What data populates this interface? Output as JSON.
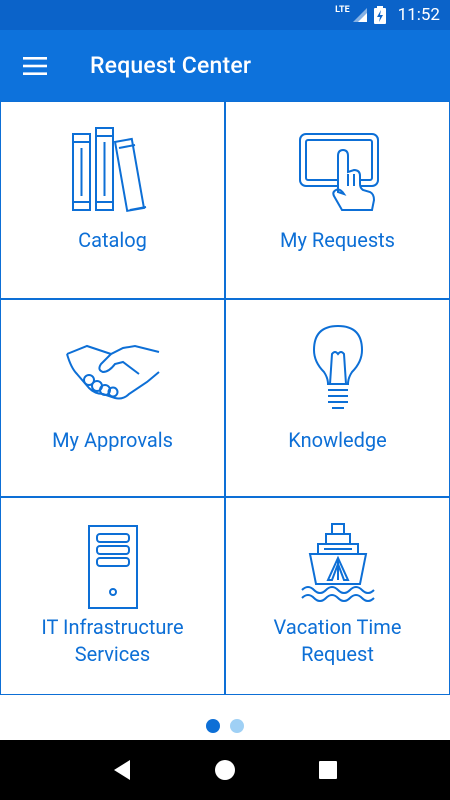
{
  "status_bar": {
    "network": "LTE",
    "time": "11:52"
  },
  "app_bar": {
    "title": "Request Center",
    "menu_icon": "hamburger-menu-icon"
  },
  "tiles": [
    {
      "label": "Catalog",
      "icon": "books-icon"
    },
    {
      "label": "My Requests",
      "icon": "tablet-touch-icon"
    },
    {
      "label": "My Approvals",
      "icon": "handshake-icon"
    },
    {
      "label": "Knowledge",
      "icon": "lightbulb-icon"
    },
    {
      "label": "IT Infrastructure\nServices",
      "icon": "server-tower-icon"
    },
    {
      "label": "Vacation Time\nRequest",
      "icon": "ship-icon"
    }
  ],
  "pager": {
    "pages": 2,
    "current": 1
  },
  "nav_bar": {
    "buttons": [
      "back-icon",
      "home-icon",
      "recents-icon"
    ]
  },
  "colors": {
    "accent": "#0d6fd6",
    "app_bar": "#0d72dc",
    "status_bar": "#0b63c9",
    "dot_inactive": "#9fd0f5"
  }
}
